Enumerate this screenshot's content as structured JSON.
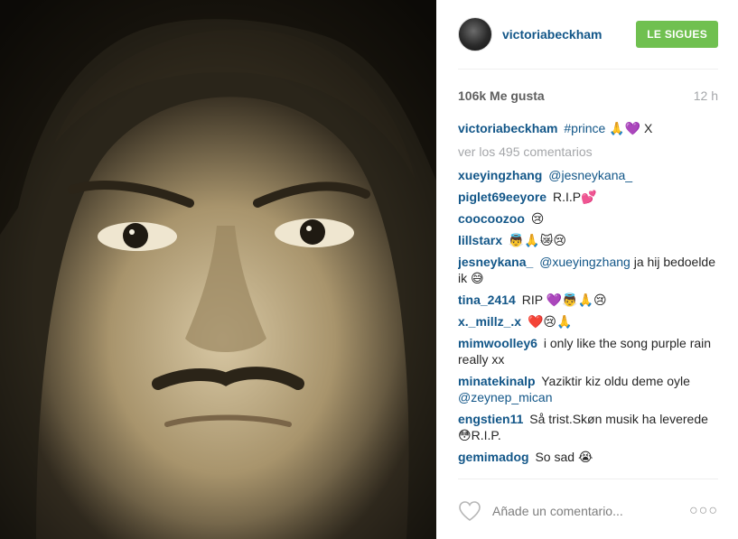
{
  "post": {
    "username": "victoriabeckham",
    "follow_label": "LE SIGUES",
    "likes": "106k Me gusta",
    "time_ago": "12 h",
    "caption": {
      "username": "victoriabeckham",
      "hashtag": "#prince",
      "emojis": "🙏💜",
      "tail": "X"
    },
    "view_all_comments": "ver los 495 comentarios",
    "comments": [
      {
        "user": "xueyingzhang",
        "text": "",
        "mention": "@jesneykana_"
      },
      {
        "user": "piglet69eeyore",
        "text": "R.I.P💕",
        "mention": ""
      },
      {
        "user": "coocoozoo",
        "text": "😢",
        "mention": ""
      },
      {
        "user": "lillstarx",
        "text": "👼🙏😿😢",
        "mention": ""
      },
      {
        "user": "jesneykana_",
        "text": "ja hij bedoelde ik 😅",
        "mention": "@xueyingzhang",
        "mention_first": true
      },
      {
        "user": "tina_2414",
        "text": "RIP 💜👼🙏😢",
        "mention": ""
      },
      {
        "user": "x._millz_.x",
        "text": "❤️😢🙏",
        "mention": ""
      },
      {
        "user": "mimwoolley6",
        "text": "i only like the song purple rain really xx",
        "mention": ""
      },
      {
        "user": "minatekinalp",
        "text": "Yaziktir kiz oldu deme oyle",
        "mention": "@zeynep_mican",
        "mention_after": true
      },
      {
        "user": "engstien11",
        "text": "Så trist.Skøn musik ha leverede😳R.I.P.",
        "mention": ""
      },
      {
        "user": "gemimadog",
        "text": "So sad 😭",
        "mention": ""
      }
    ],
    "comment_placeholder": "Añade un comentario...",
    "more_icon": "more-dots-icon",
    "heart_icon": "heart-icon"
  },
  "colors": {
    "accent": "#125688",
    "follow_button": "#70c050",
    "muted": "#a5a7aa"
  }
}
